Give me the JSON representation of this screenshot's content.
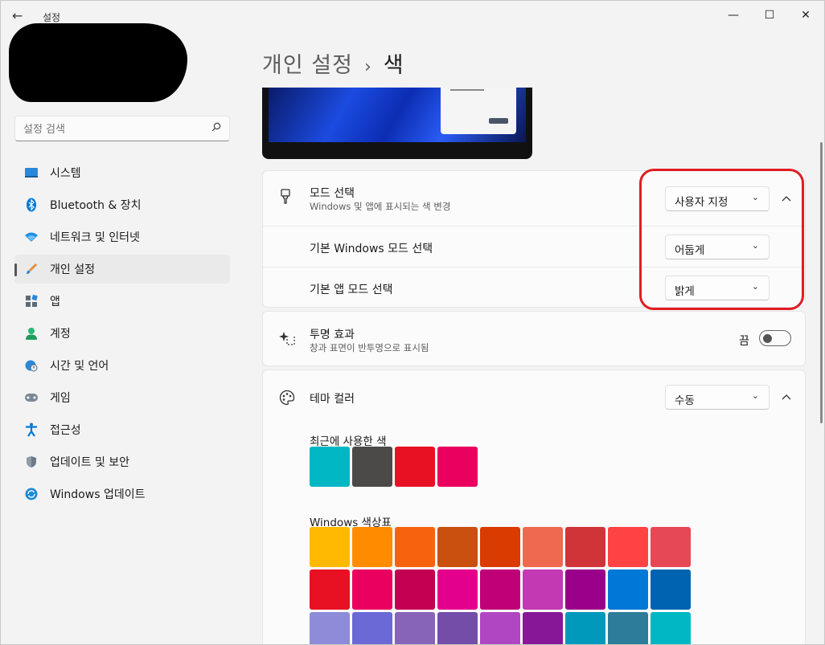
{
  "window": {
    "title": "설정",
    "back_icon": "←",
    "min_icon": "—",
    "max_icon": "☐",
    "close_icon": "✕"
  },
  "search": {
    "placeholder": "설정 검색"
  },
  "sidebar": {
    "items": [
      {
        "label": "시스템",
        "icon": "monitor-icon",
        "active": false
      },
      {
        "label": "Bluetooth & 장치",
        "icon": "bluetooth-icon",
        "active": false
      },
      {
        "label": "네트워크 및 인터넷",
        "icon": "wifi-icon",
        "active": false
      },
      {
        "label": "개인 설정",
        "icon": "paint-brush-icon",
        "active": true
      },
      {
        "label": "앱",
        "icon": "apps-icon",
        "active": false
      },
      {
        "label": "계정",
        "icon": "person-icon",
        "active": false
      },
      {
        "label": "시간 및 언어",
        "icon": "globe-clock-icon",
        "active": false
      },
      {
        "label": "게임",
        "icon": "gamepad-icon",
        "active": false
      },
      {
        "label": "접근성",
        "icon": "accessibility-icon",
        "active": false
      },
      {
        "label": "업데이트 및 보안",
        "icon": "shield-icon",
        "active": false
      },
      {
        "label": "Windows 업데이트",
        "icon": "update-icon",
        "active": false
      }
    ]
  },
  "header": {
    "crumb": "개인 설정",
    "separator": "›",
    "current": "색"
  },
  "mode": {
    "title": "모드 선택",
    "subtitle": "Windows 및 앱에 표시되는 색 변경",
    "value": "사용자 지정",
    "windows_mode_label": "기본 Windows 모드 선택",
    "windows_mode_value": "어둡게",
    "app_mode_label": "기본 앱 모드 선택",
    "app_mode_value": "밝게"
  },
  "transparency": {
    "title": "투명 효과",
    "subtitle": "창과 표면이 반투명으로 표시됨",
    "state_label": "끔",
    "on": false
  },
  "theme_color": {
    "title": "테마 컬러",
    "value": "수동",
    "recent_label": "최근에 사용한 색",
    "recent_colors": [
      "#00b7c3",
      "#4c4a48",
      "#e81123",
      "#ea005e"
    ],
    "palette_label": "Windows 색상표",
    "palette_colors": [
      "#ffb900",
      "#ff8c00",
      "#f7630c",
      "#ca5010",
      "#da3b01",
      "#ef6950",
      "#d13438",
      "#ff4343",
      "#e74856",
      "#e81123",
      "#ea005e",
      "#c30052",
      "#e3008c",
      "#bf0077",
      "#c239b3",
      "#9a0089",
      "#0078d7",
      "#0063b1",
      "#8e8cd8",
      "#6b69d6",
      "#8764b8",
      "#744da9",
      "#b146c2",
      "#881798",
      "#0099bc",
      "#2d7d9a",
      "#00b7c3"
    ]
  },
  "icons": {
    "chevron": "⌄",
    "collapse": "^"
  }
}
